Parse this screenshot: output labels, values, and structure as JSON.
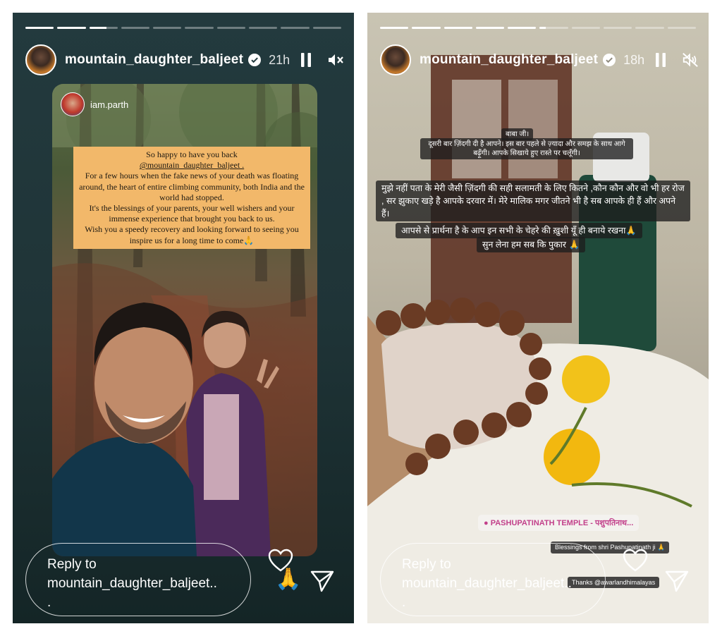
{
  "stories": [
    {
      "username": "mountain_daughter_baljeet",
      "time": "21h",
      "progress_segments": 10,
      "active_segment": 3,
      "active_fraction": 0.6,
      "reshare": {
        "username": "iam.parth",
        "text_lines": [
          "So happy to have you back",
          "@mountain_daughter_baljeet .",
          "For a few hours when the fake news of your death was floating around, the heart of entire climbing community, both India and the world had stopped.",
          "It's the blessings of your parents, your well wishers and your immense experience that brought you back to us.",
          "Wish you a speedy recovery and looking forward to seeing you inspire us for a long time to come🙏"
        ]
      },
      "reply_placeholder": "Reply to mountain_daughter_baljeet..",
      "reply_dot": ".",
      "reaction_emoji": "🙏"
    },
    {
      "username": "mountain_daughter_baljeet",
      "time": "18h",
      "progress_segments": 10,
      "active_segment": 6,
      "active_fraction": 0.2,
      "texts": [
        "बाबा जी।",
        "दूसरी बार ज़िंदगी दी है आपने। इस बार पहले से ज़्यादा और समझ के साथ आगे बढ़ूँगी। आपके सिखाये हुए रास्ते पर चलूँगी।",
        "मुझे नहीं पता के मेरी जैसी ज़िंदगी की सही सलामती के लिए कितने ,कौन कौन और वो भी हर रोज , सर झुकाए खड़े है आपके दरवार में। मेरे मालिक मगर जीतने भी है सब आपके ही हैं और अपने हैं।",
        "आपसे से प्रार्थना है के आप इन सभी के चेहरे की ख़ुशी यूँ ही बनाये रखना🙏",
        "सुन लेना हम सब कि पुकार 🙏"
      ],
      "location": "PASHUPATINATH TEMPLE - पशुपतिनाथ...",
      "blessings": "Blessings from shri Pashupatinath ji 🙏",
      "thanks": "Thanks @awarlandhimalayas",
      "reply_placeholder": "Reply to mountain_daughter_baljeet..",
      "reply_dot": "."
    }
  ],
  "icons": {
    "pause": "pause-icon",
    "mute": "mute-icon",
    "verified": "verified-badge-icon",
    "heart": "heart-icon",
    "send": "send-icon",
    "location": "location-pin-icon"
  }
}
